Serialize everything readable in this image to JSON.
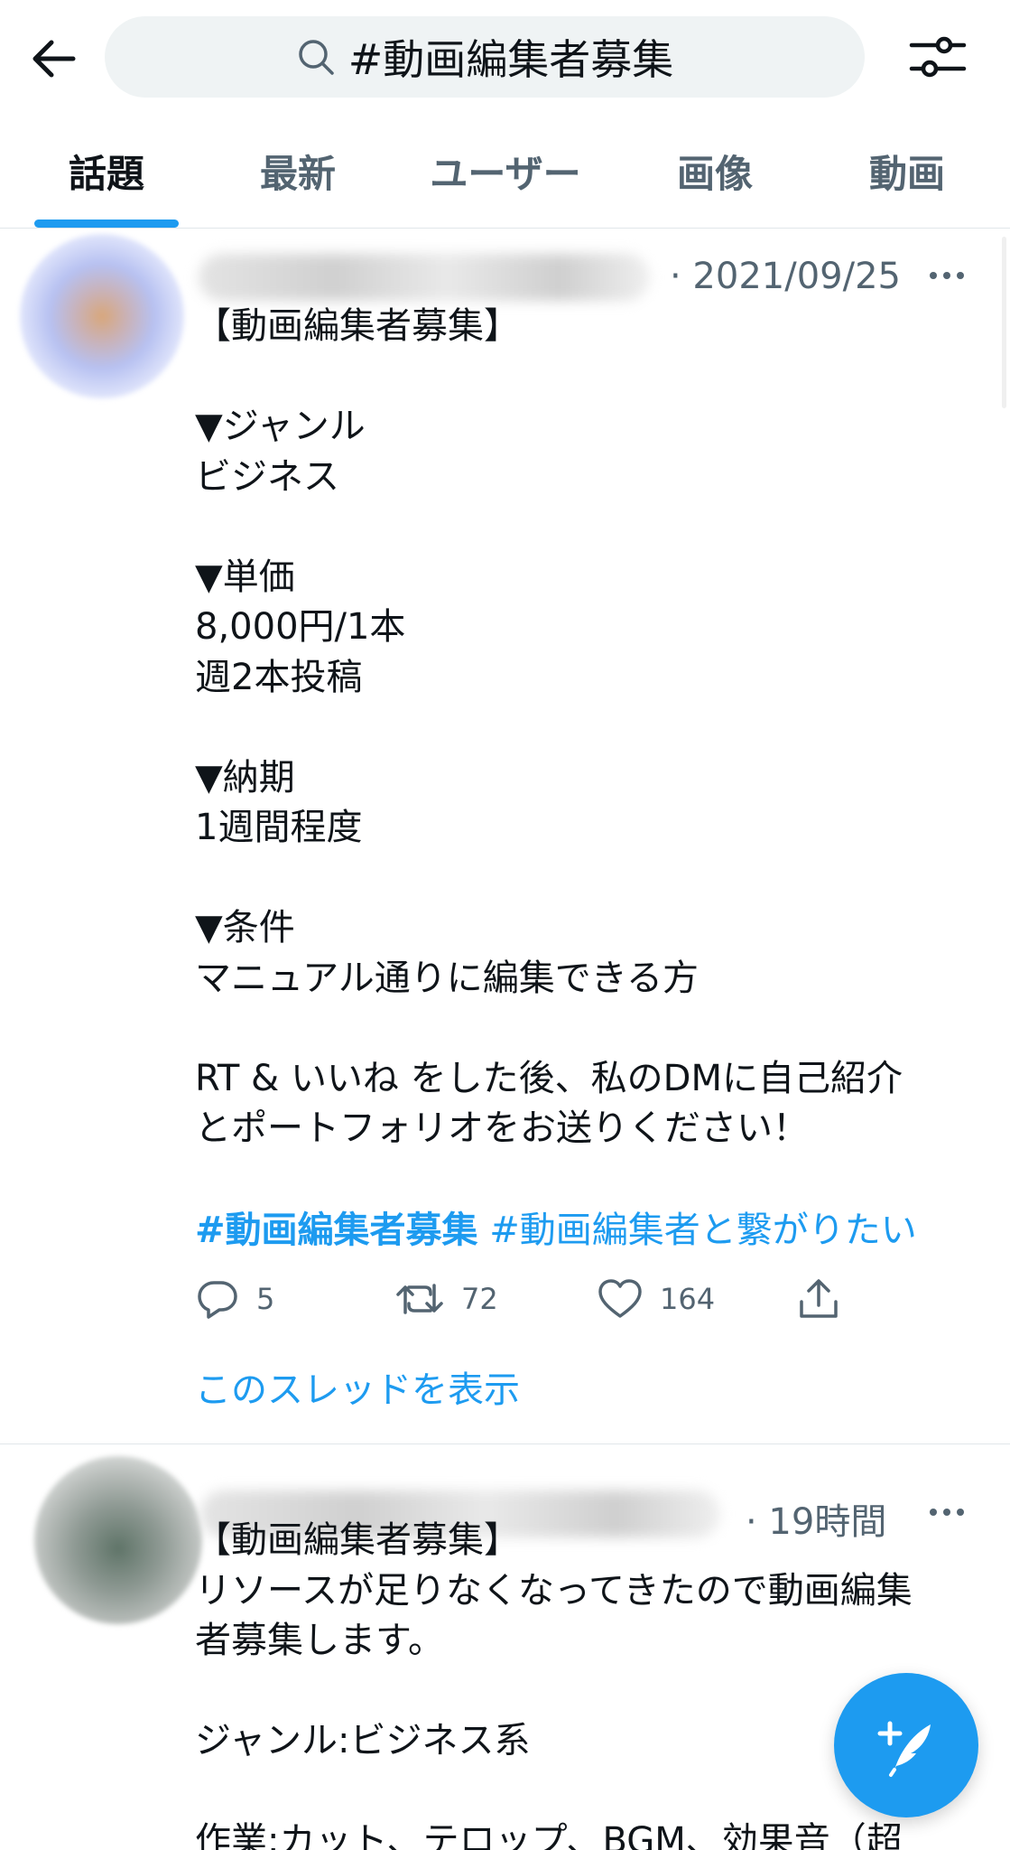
{
  "search": {
    "query": "#動画編集者募集"
  },
  "tabs": [
    {
      "label": "話題",
      "active": true
    },
    {
      "label": "最新"
    },
    {
      "label": "ユーザー"
    },
    {
      "label": "画像"
    },
    {
      "label": "動画"
    }
  ],
  "tweets": [
    {
      "date": "· 2021/09/25",
      "body": "【動画編集者募集】\n\n▼ジャンル\nビジネス\n\n▼単価\n8,000円/1本\n週2本投稿\n\n▼納期\n1週間程度\n\n▼条件\nマニュアル通りに編集できる方\n\nRT & いいね をした後、私のDMに自己紹介\nとポートフォリオをお送りください！",
      "hashtag_primary": "#動画編集者募集",
      "hashtag_secondary": "#動画編集者と繋がりたい",
      "replies": "5",
      "retweets": "72",
      "likes": "164",
      "thread_link": "このスレッドを表示"
    },
    {
      "date": "· 19時間",
      "body": "【動画編集者募集】\nリソースが足りなくなってきたので動画編集\n者募集します。\n\nジャンル:ビジネス系\n\n作業:カット、テロップ、BGM、効果音（超"
    }
  ],
  "colors": {
    "accent": "#1d9bf0",
    "secondary_text": "#536471"
  },
  "icons": {
    "back": "back-arrow-icon",
    "search": "search-icon",
    "filter": "filter-sliders-icon",
    "reply": "reply-icon",
    "retweet": "retweet-icon",
    "like": "heart-icon",
    "share": "share-icon",
    "compose": "compose-tweet-icon"
  }
}
